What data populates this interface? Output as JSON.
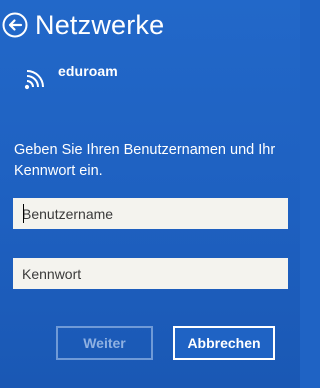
{
  "header": {
    "title": "Netzwerke",
    "back_icon": "back-arrow-icon"
  },
  "network": {
    "name": "eduroam",
    "icon": "wifi-icon"
  },
  "form": {
    "prompt_line1": "Geben Sie Ihren Benutzernamen und Ihr",
    "prompt_line2": "Kennwort ein.",
    "username_placeholder": "Benutzername",
    "username_value": "",
    "password_placeholder": "Kennwort",
    "password_value": ""
  },
  "buttons": {
    "next_label": "Weiter",
    "cancel_label": "Abbrechen"
  },
  "colors": {
    "background": "#1f63c4",
    "text": "#ffffff",
    "field_background": "#f4f3ee",
    "disabled_button_text": "#8fb1e2"
  }
}
